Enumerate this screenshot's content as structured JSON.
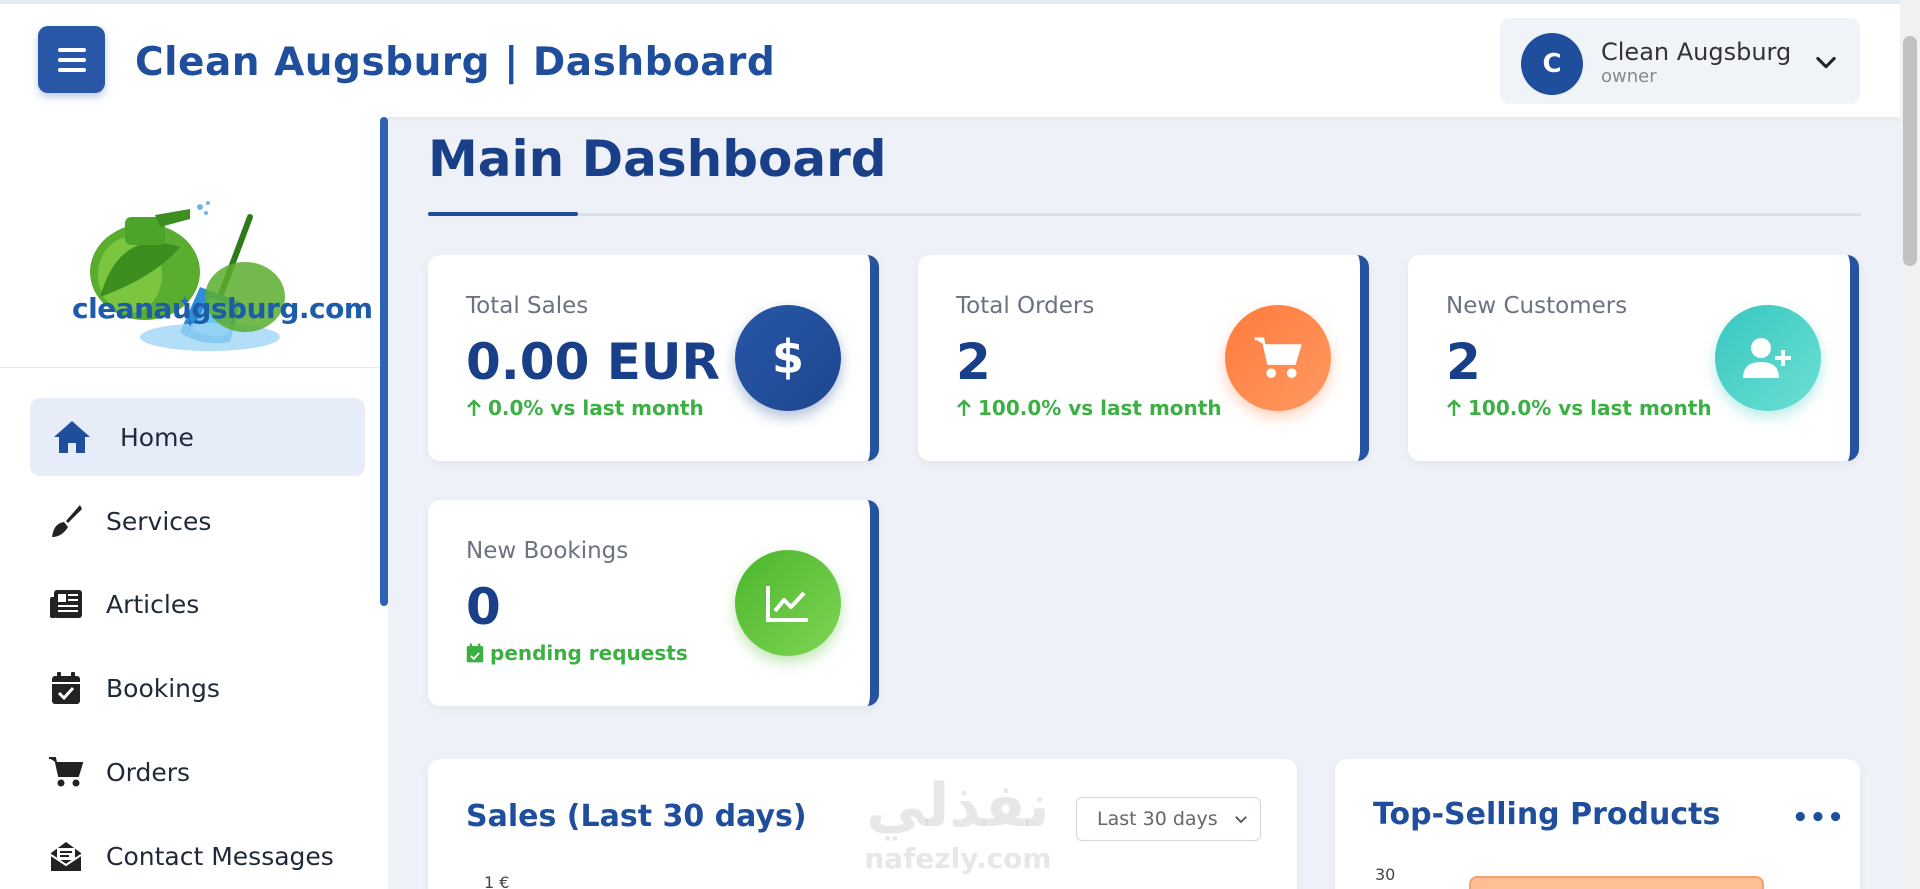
{
  "header": {
    "title": "Clean Augsburg | Dashboard",
    "user": {
      "initial": "C",
      "name": "Clean Augsburg",
      "role": "owner"
    }
  },
  "sidebar": {
    "logo_text": "cleanaugsburg.com",
    "items": [
      {
        "label": "Home",
        "icon": "home-icon",
        "active": true
      },
      {
        "label": "Services",
        "icon": "brush-icon"
      },
      {
        "label": "Articles",
        "icon": "newspaper-icon"
      },
      {
        "label": "Bookings",
        "icon": "calendar-check-icon"
      },
      {
        "label": "Orders",
        "icon": "cart-icon"
      },
      {
        "label": "Contact Messages",
        "icon": "envelope-open-icon"
      }
    ]
  },
  "main": {
    "title": "Main Dashboard",
    "stats": [
      {
        "label": "Total Sales",
        "value": "0.00 EUR",
        "trend": "0.0% vs last month",
        "icon": "dollar-icon",
        "color": "#1f4e9c"
      },
      {
        "label": "Total Orders",
        "value": "2",
        "trend": "100.0% vs last month",
        "icon": "cart-icon",
        "color": "#ff7a3c"
      },
      {
        "label": "New Customers",
        "value": "2",
        "trend": "100.0% vs last month",
        "icon": "user-plus-icon",
        "color": "#37c6c0"
      },
      {
        "label": "New Bookings",
        "value": "0",
        "trend": "pending requests",
        "icon": "chart-line-icon",
        "color": "#4cb52c"
      }
    ],
    "sales_panel": {
      "title": "Sales (Last 30 days)",
      "range": "Last 30 days",
      "y_tick": "1 €"
    },
    "top_products_panel": {
      "title": "Top-Selling Products",
      "menu": "•••",
      "y_tick": "30"
    }
  },
  "watermark": {
    "arabic": "نفذلي",
    "latin": "nafezly.com"
  },
  "colors": {
    "primary": "#1f4e9c",
    "accent_green": "#3cb043",
    "background": "#eef2f8"
  }
}
